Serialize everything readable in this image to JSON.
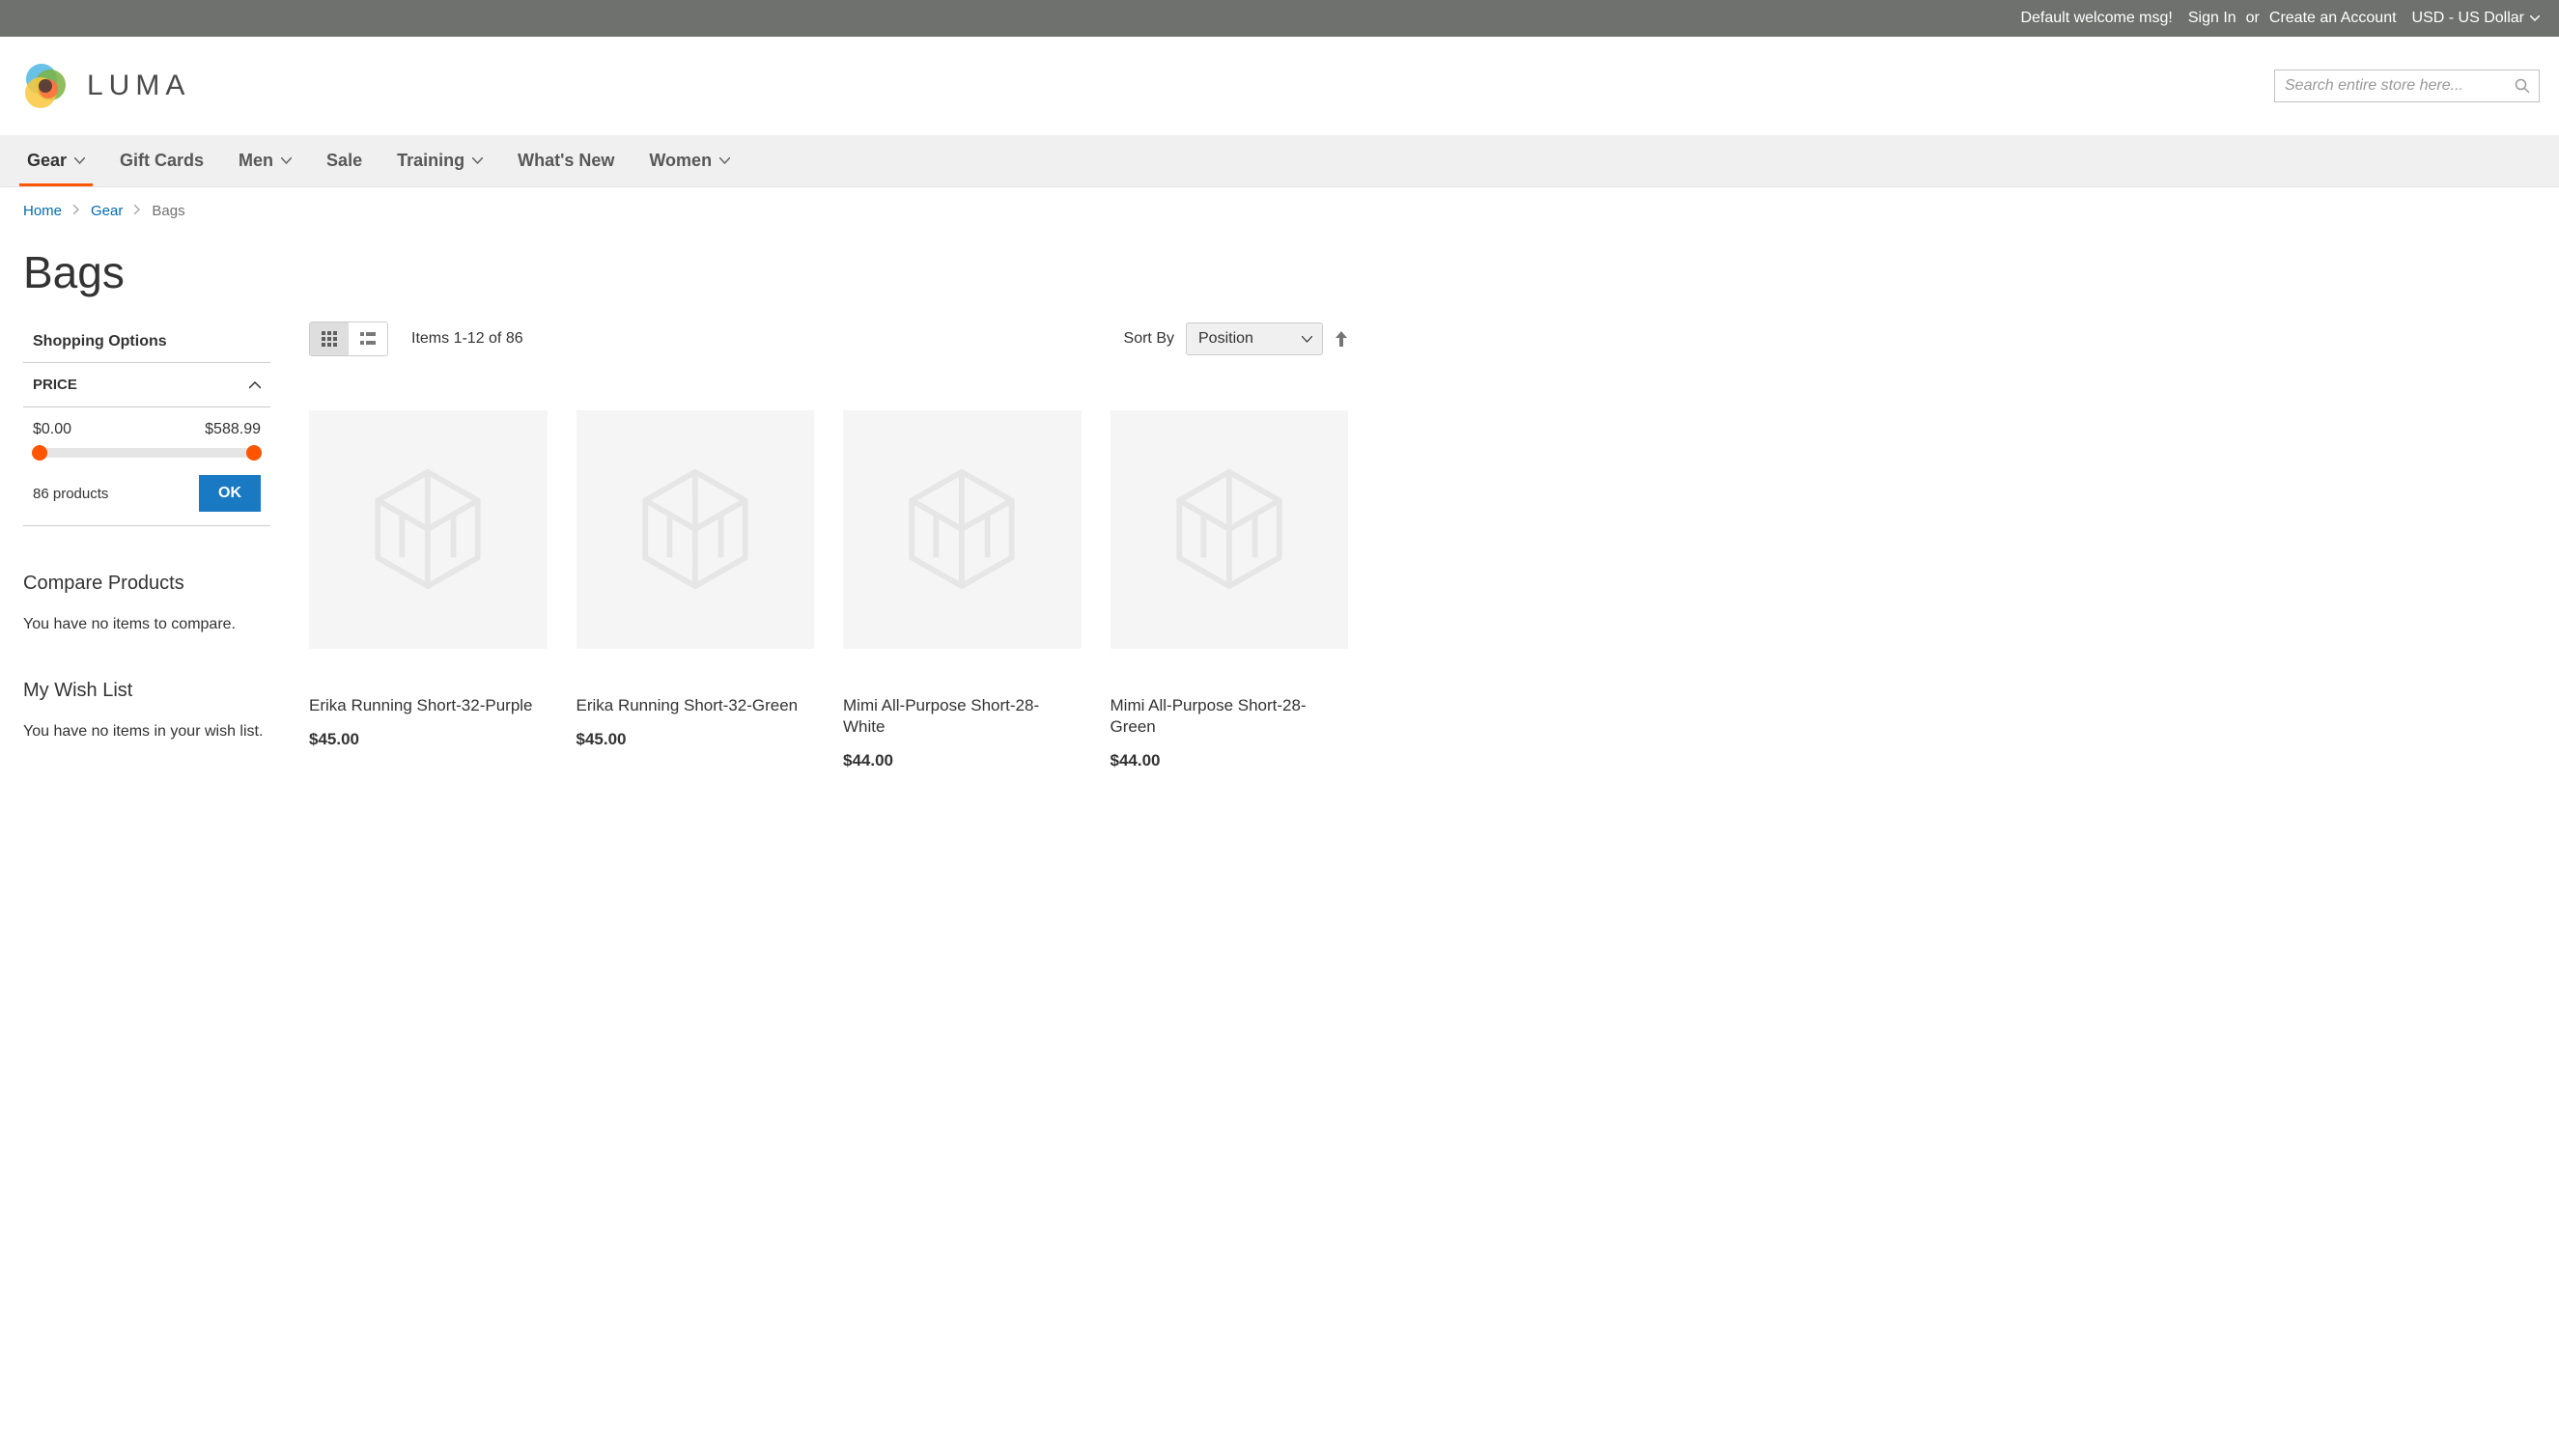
{
  "panel": {
    "welcome": "Default welcome msg!",
    "sign_in": "Sign In",
    "or": "or",
    "create_account": "Create an Account",
    "currency": "USD - US Dollar"
  },
  "header": {
    "logo_text": "LUMA",
    "search_placeholder": "Search entire store here..."
  },
  "nav": [
    {
      "label": "Gear",
      "has_children": true,
      "active": true
    },
    {
      "label": "Gift Cards",
      "has_children": false,
      "active": false
    },
    {
      "label": "Men",
      "has_children": true,
      "active": false
    },
    {
      "label": "Sale",
      "has_children": false,
      "active": false
    },
    {
      "label": "Training",
      "has_children": true,
      "active": false
    },
    {
      "label": "What's New",
      "has_children": false,
      "active": false
    },
    {
      "label": "Women",
      "has_children": true,
      "active": false
    }
  ],
  "breadcrumbs": {
    "items": [
      {
        "label": "Home",
        "link": true
      },
      {
        "label": "Gear",
        "link": true
      },
      {
        "label": "Bags",
        "link": false
      }
    ]
  },
  "page_title": "Bags",
  "sidebar": {
    "shopping_options_title": "Shopping Options",
    "price_filter": {
      "title": "PRICE",
      "min": "$0.00",
      "max": "$588.99",
      "count": "86 products",
      "ok": "OK"
    },
    "compare": {
      "title": "Compare Products",
      "empty": "You have no items to compare."
    },
    "wishlist": {
      "title": "My Wish List",
      "empty": "You have no items in your wish list."
    }
  },
  "toolbar": {
    "amount": "Items 1-12 of 86",
    "sort_by_label": "Sort By",
    "sort_value": "Position"
  },
  "products": [
    {
      "name": "Erika Running Short-32-Purple",
      "price": "$45.00"
    },
    {
      "name": "Erika Running Short-32-Green",
      "price": "$45.00"
    },
    {
      "name": "Mimi All-Purpose Short-28-White",
      "price": "$44.00"
    },
    {
      "name": "Mimi All-Purpose Short-28-Green",
      "price": "$44.00"
    }
  ]
}
